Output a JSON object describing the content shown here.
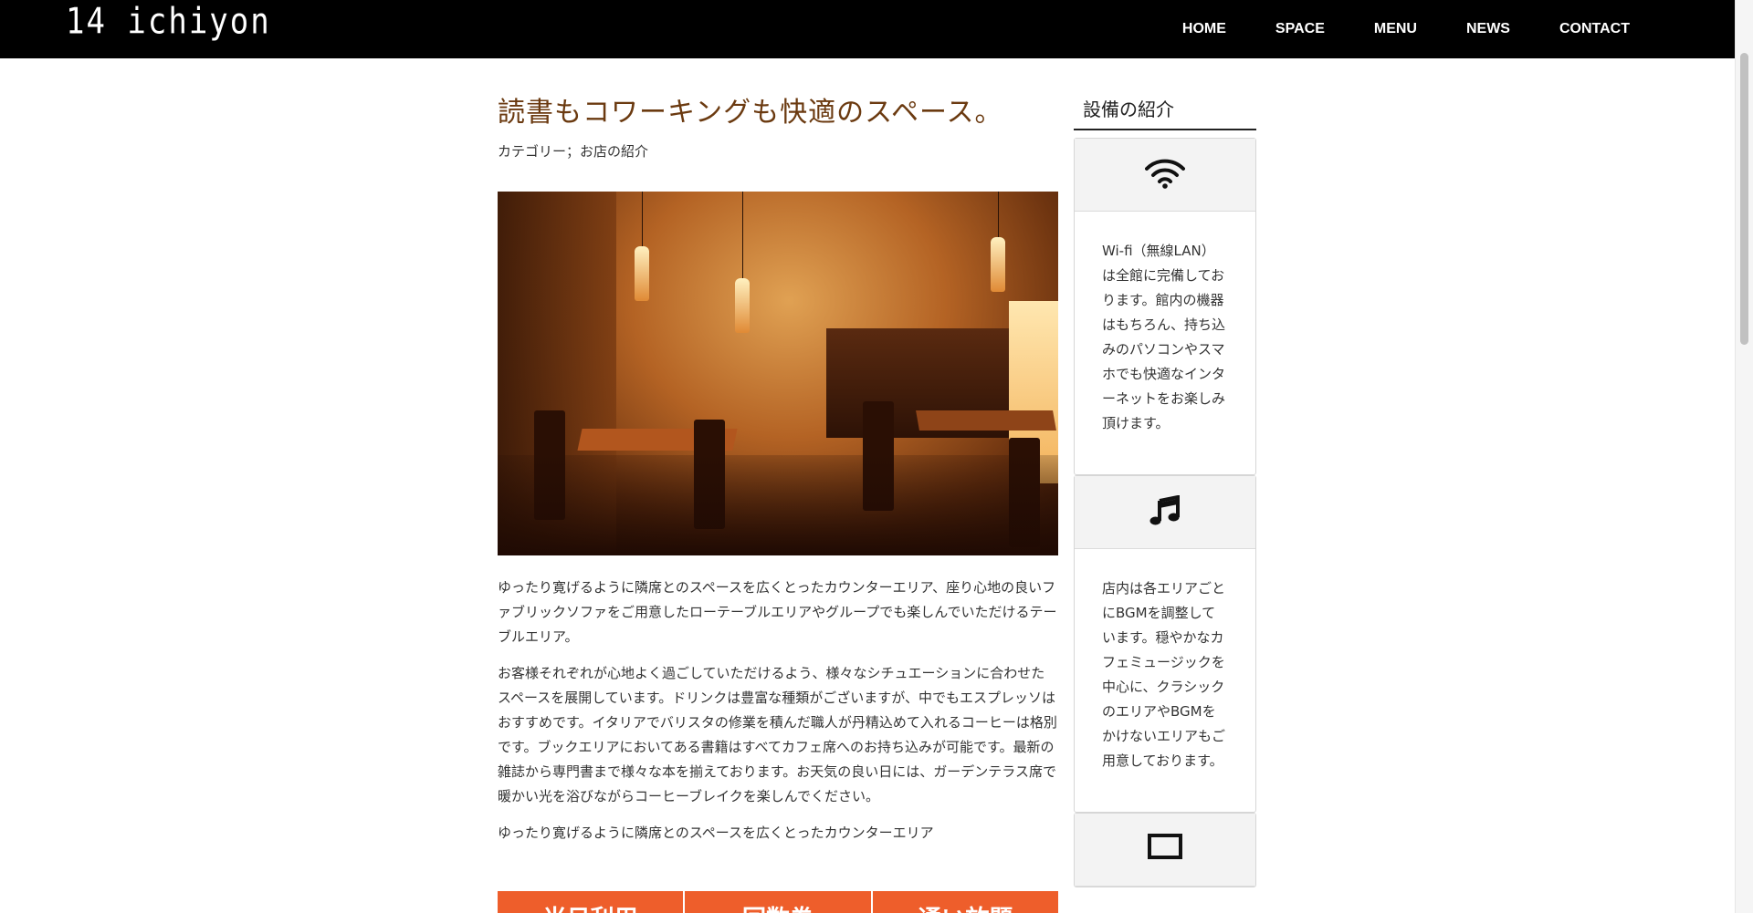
{
  "header": {
    "logo": "14 ichiyon",
    "nav": [
      "HOME",
      "SPACE",
      "MENU",
      "NEWS",
      "CONTACT"
    ]
  },
  "article": {
    "title": "読書もコワーキングも快適のスペース。",
    "category": "カテゴリー；お店の紹介",
    "paragraphs": [
      "ゆったり寛げるように隣席とのスペースを広くとったカウンターエリア、座り心地の良いファブリックソファをご用意したローテーブルエリアやグループでも楽しんでいただけるテーブルエリア。",
      "お客様それぞれが心地よく過ごしていただけるよう、様々なシチュエーションに合わせたスペースを展開しています。ドリンクは豊富な種類がございますが、中でもエスプレッソはおすすめです。イタリアでバリスタの修業を積んだ職人が丹精込めて入れるコーヒーは格別です。ブックエリアにおいてある書籍はすべてカフェ席へのお持ち込みが可能です。最新の雑誌から専門書まで様々な本を揃えております。お天気の良い日には、ガーデンテラス席で暖かい光を浴びながらコーヒーブレイクを楽しんでください。",
      "ゆったり寛げるように隣席とのスペースを広くとったカウンターエリア"
    ],
    "tabs": [
      "当日利用",
      "回数券",
      "通い放題"
    ]
  },
  "sidebar": {
    "title": "設備の紹介",
    "cards": [
      {
        "icon": "wifi-icon",
        "text": "Wi-fi（無線LAN）は全館に完備しております。館内の機器はもちろん、持ち込みのパソコンやスマホでも快適なインターネットをお楽しみ頂けます。"
      },
      {
        "icon": "music-note-icon",
        "text": "店内は各エリアごとにBGMを調整しています。穏やかなカフェミュージックを中心に、クラシックのエリアやBGMをかけないエリアもご用意しております。"
      },
      {
        "icon": "monitor-icon",
        "text": ""
      }
    ]
  },
  "colors": {
    "header_bg": "#000000",
    "title": "#6b3a10",
    "accent": "#ee5e2b"
  }
}
